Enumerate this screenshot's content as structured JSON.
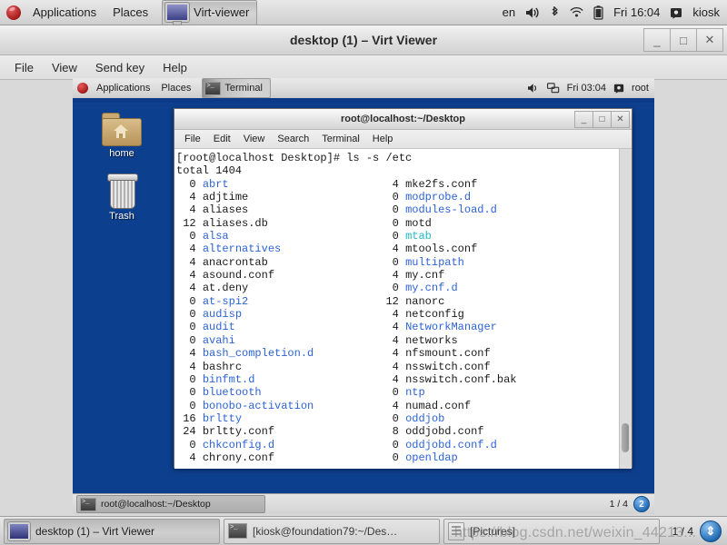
{
  "host_panel": {
    "logo_icon": "fedora-logo-icon",
    "applications": "Applications",
    "places": "Places",
    "active_task": "Virt-viewer",
    "active_task_icon": "monitor-icon",
    "keyboard_layout": "en",
    "volume_icon": "volume-icon",
    "bluetooth_icon": "bluetooth-icon",
    "network_icon": "wifi-icon",
    "battery_icon": "battery-icon",
    "clock": "Fri 16:04",
    "user_icon": "user-icon",
    "user": "kiosk"
  },
  "virt_viewer": {
    "title": "desktop (1) – Virt Viewer",
    "minimize": "_",
    "maximize": "□",
    "close": "✕",
    "menu": [
      "File",
      "View",
      "Send key",
      "Help"
    ]
  },
  "guest_panel": {
    "logo_icon": "fedora-logo-icon",
    "applications": "Applications",
    "places": "Places",
    "active_task": "Terminal",
    "active_task_icon": "terminal-icon",
    "volume_icon": "volume-icon",
    "network_icon": "network-icon",
    "clock": "Fri 03:04",
    "user_icon": "user-icon",
    "user": "root"
  },
  "desktop_icons": [
    {
      "label": "home",
      "icon": "home-folder-icon"
    },
    {
      "label": "Trash",
      "icon": "trash-icon"
    }
  ],
  "terminal": {
    "title": "root@localhost:~/Desktop",
    "minimize": "_",
    "maximize": "□",
    "close": "✕",
    "menu": [
      "File",
      "Edit",
      "View",
      "Search",
      "Terminal",
      "Help"
    ],
    "prompt_line": "[root@localhost Desktop]# ls -s /etc",
    "total_line": "total 1404",
    "rows": [
      {
        "ls": "0",
        "ln": "abrt",
        "lc": "blue",
        "rs": "4",
        "rn": "mke2fs.conf",
        "rc": ""
      },
      {
        "ls": "4",
        "ln": "adjtime",
        "lc": "",
        "rs": "0",
        "rn": "modprobe.d",
        "rc": "blue"
      },
      {
        "ls": "4",
        "ln": "aliases",
        "lc": "",
        "rs": "0",
        "rn": "modules-load.d",
        "rc": "blue"
      },
      {
        "ls": "12",
        "ln": "aliases.db",
        "lc": "",
        "rs": "0",
        "rn": "motd",
        "rc": ""
      },
      {
        "ls": "0",
        "ln": "alsa",
        "lc": "blue",
        "rs": "0",
        "rn": "mtab",
        "rc": "cyan"
      },
      {
        "ls": "4",
        "ln": "alternatives",
        "lc": "blue",
        "rs": "4",
        "rn": "mtools.conf",
        "rc": ""
      },
      {
        "ls": "4",
        "ln": "anacrontab",
        "lc": "",
        "rs": "0",
        "rn": "multipath",
        "rc": "blue"
      },
      {
        "ls": "4",
        "ln": "asound.conf",
        "lc": "",
        "rs": "4",
        "rn": "my.cnf",
        "rc": ""
      },
      {
        "ls": "4",
        "ln": "at.deny",
        "lc": "",
        "rs": "0",
        "rn": "my.cnf.d",
        "rc": "blue"
      },
      {
        "ls": "0",
        "ln": "at-spi2",
        "lc": "blue",
        "rs": "12",
        "rn": "nanorc",
        "rc": ""
      },
      {
        "ls": "0",
        "ln": "audisp",
        "lc": "blue",
        "rs": "4",
        "rn": "netconfig",
        "rc": ""
      },
      {
        "ls": "0",
        "ln": "audit",
        "lc": "blue",
        "rs": "4",
        "rn": "NetworkManager",
        "rc": "blue"
      },
      {
        "ls": "0",
        "ln": "avahi",
        "lc": "blue",
        "rs": "4",
        "rn": "networks",
        "rc": ""
      },
      {
        "ls": "4",
        "ln": "bash_completion.d",
        "lc": "blue",
        "rs": "4",
        "rn": "nfsmount.conf",
        "rc": ""
      },
      {
        "ls": "4",
        "ln": "bashrc",
        "lc": "",
        "rs": "4",
        "rn": "nsswitch.conf",
        "rc": ""
      },
      {
        "ls": "0",
        "ln": "binfmt.d",
        "lc": "blue",
        "rs": "4",
        "rn": "nsswitch.conf.bak",
        "rc": ""
      },
      {
        "ls": "0",
        "ln": "bluetooth",
        "lc": "blue",
        "rs": "0",
        "rn": "ntp",
        "rc": "blue"
      },
      {
        "ls": "0",
        "ln": "bonobo-activation",
        "lc": "blue",
        "rs": "4",
        "rn": "numad.conf",
        "rc": ""
      },
      {
        "ls": "16",
        "ln": "brltty",
        "lc": "blue",
        "rs": "0",
        "rn": "oddjob",
        "rc": "blue"
      },
      {
        "ls": "24",
        "ln": "brltty.conf",
        "lc": "",
        "rs": "8",
        "rn": "oddjobd.conf",
        "rc": ""
      },
      {
        "ls": "0",
        "ln": "chkconfig.d",
        "lc": "blue",
        "rs": "0",
        "rn": "oddjobd.conf.d",
        "rc": "blue"
      },
      {
        "ls": "4",
        "ln": "chrony.conf",
        "lc": "",
        "rs": "0",
        "rn": "openldap",
        "rc": "blue"
      }
    ]
  },
  "guest_taskbar": {
    "task_label": "root@localhost:~/Desktop",
    "task_icon": "terminal-icon",
    "workspace_indicator": "1 / 4",
    "workspace_badge": "2"
  },
  "host_taskbar": {
    "buttons": [
      {
        "label": "desktop (1) – Virt Viewer",
        "icon": "monitor-icon",
        "state": "active"
      },
      {
        "label": "[kiosk@foundation79:~/Des…",
        "icon": "terminal-icon",
        "state": "idle"
      },
      {
        "label": "[Pictures]",
        "icon": "file-manager-icon",
        "state": "idle"
      }
    ],
    "workspace_indicator": "1 / 4",
    "workspace_badge": "⇕"
  },
  "watermark": "https://blog.csdn.net/weixin_44213...",
  "colors": {
    "desktop_blue": "#0d3f8f",
    "panel_gray": "#dcdcdc",
    "terminal_bg": "#ffffff",
    "dir_blue": "#2d63d4",
    "link_cyan": "#1fb8c4"
  }
}
